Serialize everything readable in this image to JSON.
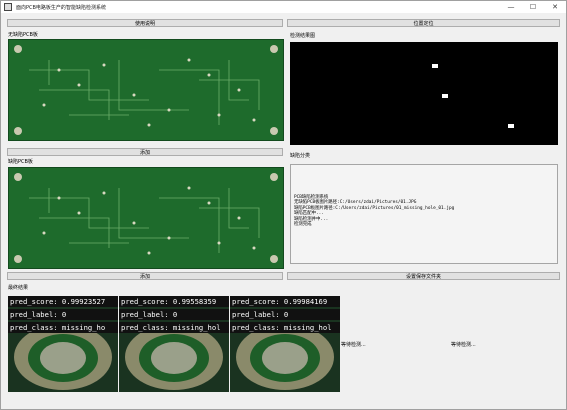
{
  "window": {
    "title": "面向PCB电路板生产的智能缺陷检测系统",
    "controls": [
      "—",
      "☐",
      "✕"
    ]
  },
  "buttons": {
    "usage": "使用说明",
    "locate": "位置定位",
    "add_top": "添加",
    "add_bottom": "添加",
    "set_save": "设置保存文件夹"
  },
  "labels": {
    "good_pcb": "无缺陷PCB板",
    "defect_pcb": "缺陷PCB板",
    "result_img": "检测结果图",
    "defect_class": "缺陷分类",
    "final_result": "最终结果"
  },
  "log_lines": [
    "PCB缺陷检测系统",
    "无缺陷PCB板图片路径:C:/Users/zdai/Pictures/01.JPG",
    "缺陷PCB板图片路径:C:/Users/zdai/Pictures/01_missing_hole_01.jpg",
    "缺陷匹配中...",
    "缺陷检测并中...",
    "检测完成"
  ],
  "crops": [
    {
      "score": "pred_score: 0.99923527",
      "label": "pred_label: 0",
      "class": "pred_class: missing_ho"
    },
    {
      "score": "pred_score: 0.99558359",
      "label": "pred_label: 0",
      "class": "pred_class: missing_hol"
    },
    {
      "score": "pred_score: 0.99984169",
      "label": "pred_label: 0",
      "class": "pred_class: missing_hol"
    }
  ],
  "waiting": [
    "等待检测...",
    "等待检测..."
  ],
  "colors": {
    "pcb_green": "#1e6b2c",
    "result_bg": "#000000"
  }
}
